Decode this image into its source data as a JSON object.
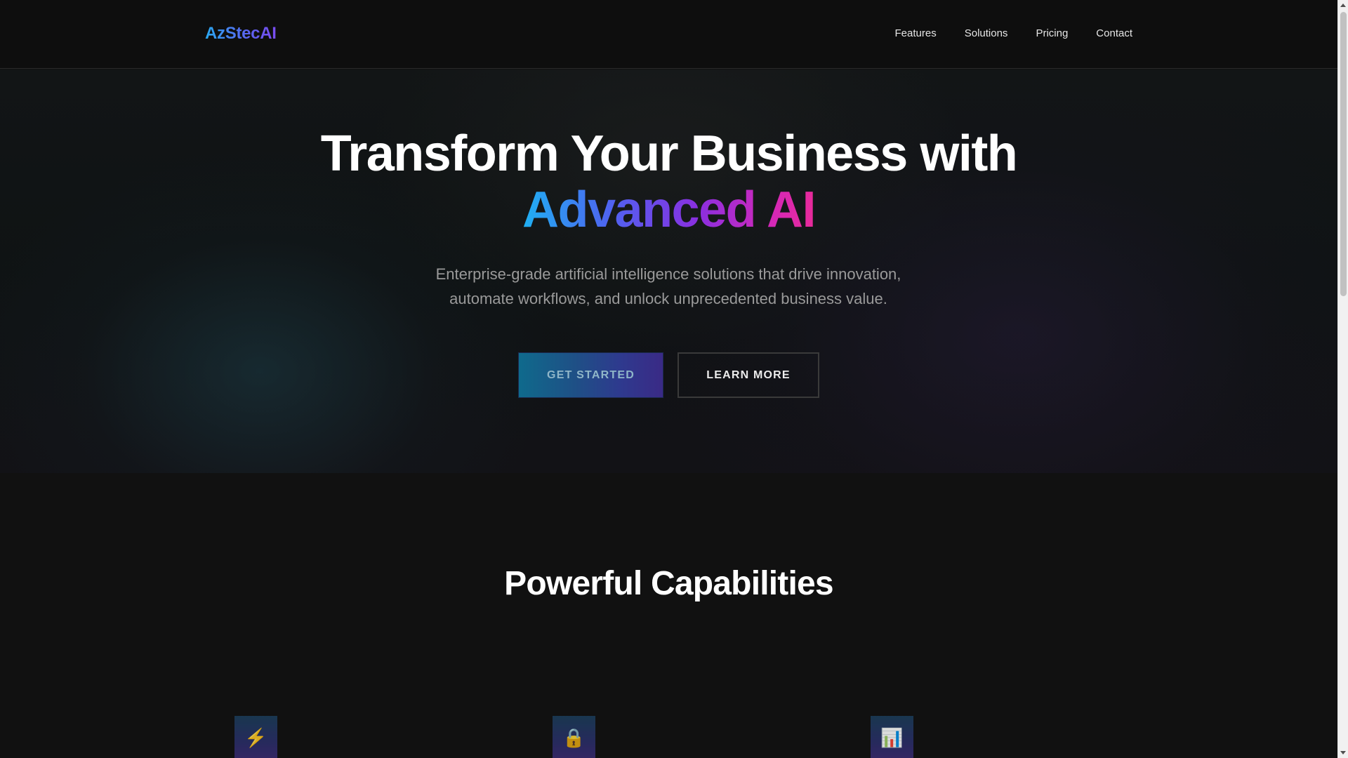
{
  "header": {
    "logo": "AzStecAI",
    "nav": [
      {
        "label": "Features"
      },
      {
        "label": "Solutions"
      },
      {
        "label": "Pricing"
      },
      {
        "label": "Contact"
      }
    ]
  },
  "hero": {
    "title_line1": "Transform Your Business with",
    "title_line2": "Advanced AI",
    "subtitle": "Enterprise-grade artificial intelligence solutions that drive innovation, automate workflows, and unlock unprecedented business value.",
    "primary_button": "GET STARTED",
    "secondary_button": "LEARN MORE"
  },
  "features": {
    "title": "Powerful Capabilities",
    "items": [
      {
        "icon": "lightning-icon",
        "glyph": "⚡"
      },
      {
        "icon": "lock-icon",
        "glyph": "🔒"
      },
      {
        "icon": "bar-chart-icon",
        "glyph": "📊"
      }
    ]
  },
  "colors": {
    "background": "#111111",
    "accent_blue": "#1fb0f2",
    "accent_purple": "#8a2fe0",
    "accent_pink": "#e82a9a"
  }
}
